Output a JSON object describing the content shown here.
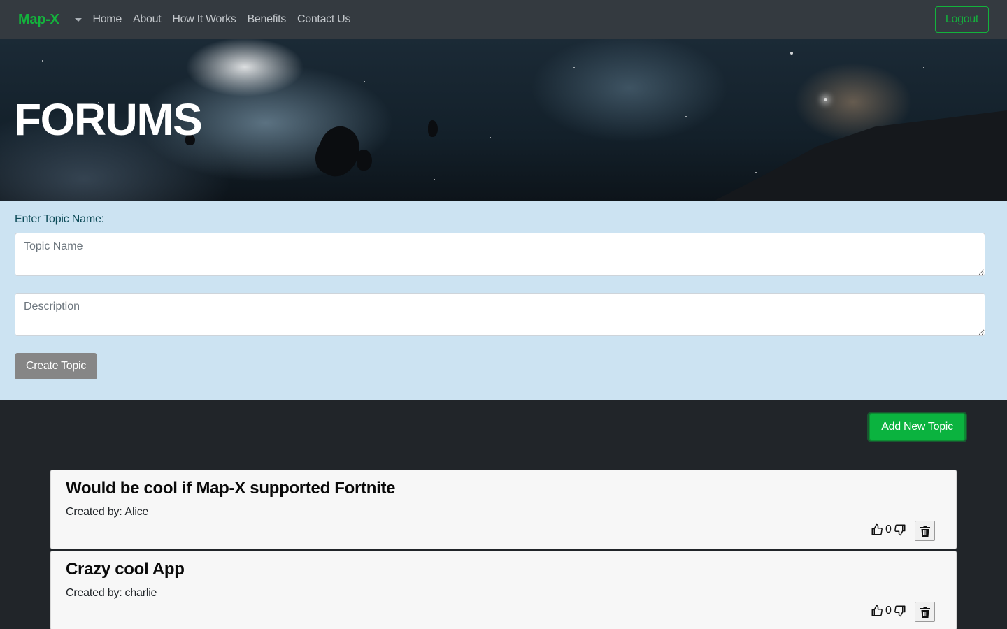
{
  "navbar": {
    "brand": "Map-X",
    "links": [
      "Home",
      "About",
      "How It Works",
      "Benefits",
      "Contact Us"
    ],
    "logout_label": "Logout"
  },
  "hero": {
    "title": "FORUMS"
  },
  "form": {
    "label": "Enter Topic Name:",
    "topic_placeholder": "Topic Name",
    "description_placeholder": "Description",
    "create_label": "Create Topic"
  },
  "add_topic_label": "Add New Topic",
  "topics": [
    {
      "title": "Would be cool if Map-X supported Fortnite",
      "created_by_prefix": "Created by:",
      "author": "Alice",
      "votes": "0"
    },
    {
      "title": "Crazy cool App",
      "created_by_prefix": "Created by:",
      "author": "charlie",
      "votes": "0"
    }
  ],
  "colors": {
    "navbar_bg": "#343a40",
    "brand_green": "#13b33c",
    "form_bg": "#cce3f2",
    "page_bg": "#212529",
    "add_button": "#0bb33f",
    "create_button": "#868686"
  }
}
